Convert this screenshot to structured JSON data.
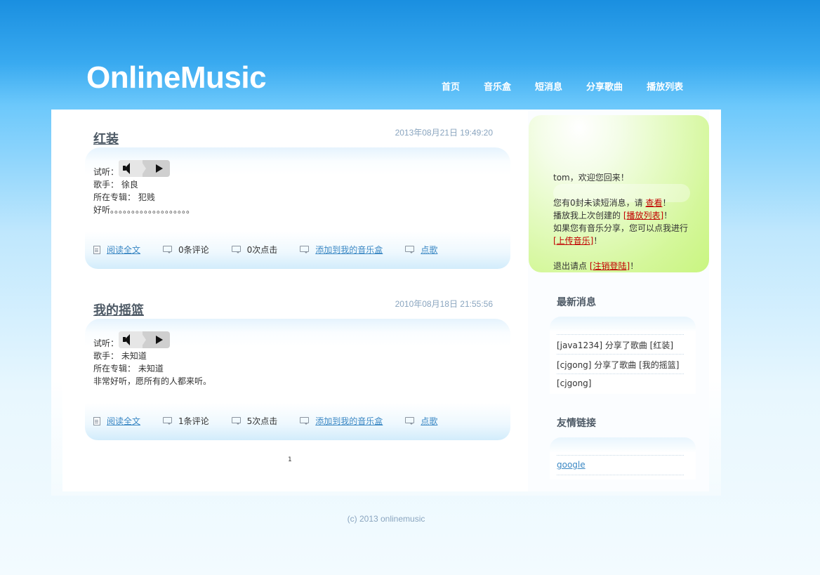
{
  "site": {
    "logo": "OnlineMusic"
  },
  "nav": {
    "items": [
      "首页",
      "音乐盒",
      "短消息",
      "分享歌曲",
      "播放列表"
    ]
  },
  "posts": [
    {
      "title": "红装",
      "date": "2013年08月21日 19:49:20",
      "listen_label": "试听：",
      "singer": "歌手： 徐良",
      "album": "所在专辑： 犯贱",
      "desc": "好听。。。。。。。。。。。。。。。。。。。",
      "read_more": "阅读全文",
      "comments": "0条评论",
      "clicks": "0次点击",
      "add_to_box": "添加到我的音乐盒",
      "request": "点歌"
    },
    {
      "title": "我的摇篮",
      "date": "2010年08月18日 21:55:56",
      "listen_label": "试听：",
      "singer": "歌手： 未知道",
      "album": "所在专辑： 未知道",
      "desc": "非常好听，愿所有的人都来听。",
      "read_more": "阅读全文",
      "comments": "1条评论",
      "clicks": "5次点击",
      "add_to_box": "添加到我的音乐盒",
      "request": "点歌"
    }
  ],
  "pager": {
    "page": "1"
  },
  "welcome": {
    "greeting": "tom，欢迎您回来！",
    "unread_prefix": "您有0封未读短消息，请 ",
    "unread_link": "查看",
    "unread_suffix": "！",
    "playlist_prefix": "播放我上次创建的 ",
    "playlist_link": "[播放列表]",
    "playlist_suffix": "！",
    "share_prefix": "如果您有音乐分享，您可以点我进行 ",
    "share_link": "[上传音乐]",
    "share_suffix": "！",
    "logout_prefix": "退出请点 ",
    "logout_link": "[注销登陆]",
    "logout_suffix": "！"
  },
  "news": {
    "title": "最新消息",
    "items": [
      "[java1234] 分享了歌曲 [红装]",
      "[cjgong] 分享了歌曲 [我的摇篮]",
      "[cjgong]"
    ]
  },
  "links": {
    "title": "友情链接",
    "items": [
      "google"
    ]
  },
  "footer": {
    "text": "(c) 2013 onlinemusic"
  },
  "icons": {
    "player_speaker": "speaker-icon",
    "player_play": "play-icon",
    "read": "document-icon",
    "comment": "comment-icon",
    "click": "comment-icon",
    "add": "comment-icon",
    "request": "comment-icon"
  }
}
